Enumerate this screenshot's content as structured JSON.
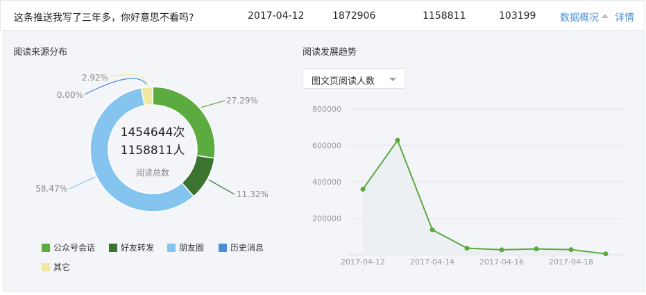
{
  "header": {
    "title": "这条推送我写了三年多，你好意思不看吗?",
    "date": "2017-04-12",
    "value1": "1872906",
    "value2": "1158811",
    "value3": "103199",
    "overview_link": "数据概况",
    "detail_link": "详情"
  },
  "source": {
    "title": "阅读来源分布",
    "center_reads": "1454644次",
    "center_users": "1158811人",
    "center_caption": "阅读总数",
    "legend": [
      {
        "label": "公众号会话",
        "color": "#5cab40"
      },
      {
        "label": "好友转发",
        "color": "#3b7330"
      },
      {
        "label": "朋友圈",
        "color": "#84c4ef"
      },
      {
        "label": "历史消息",
        "color": "#4a8fd6"
      },
      {
        "label": "其它",
        "color": "#eee99e"
      }
    ]
  },
  "trend": {
    "title": "阅读发展趋势",
    "dropdown_value": "图文页阅读人数"
  },
  "chart_data": [
    {
      "type": "pie",
      "title": "阅读来源分布",
      "categories": [
        "公众号会话",
        "好友转发",
        "朋友圈",
        "历史消息",
        "其它"
      ],
      "values": [
        27.29,
        11.32,
        58.47,
        0.0,
        2.92
      ],
      "labels": [
        "27.29%",
        "11.32%",
        "58.47%",
        "0.00%",
        "2.92%"
      ],
      "colors": [
        "#5cab40",
        "#3b7330",
        "#84c4ef",
        "#4a8fd6",
        "#eee99e"
      ]
    },
    {
      "type": "area",
      "title": "阅读发展趋势",
      "x": [
        "2017-04-12",
        "2017-04-13",
        "2017-04-14",
        "2017-04-15",
        "2017-04-16",
        "2017-04-17",
        "2017-04-18",
        "2017-04-19"
      ],
      "xticks": [
        "2017-04-12",
        "2017-04-14",
        "2017-04-16",
        "2017-04-18"
      ],
      "yticks": [
        "200000",
        "400000",
        "600000",
        "800000"
      ],
      "ylim": [
        0,
        800000
      ],
      "series": [
        {
          "values": [
            360000,
            628000,
            137000,
            36000,
            27000,
            32000,
            28000,
            5000
          ],
          "color": "#5aa83f"
        }
      ],
      "grid": true
    }
  ]
}
